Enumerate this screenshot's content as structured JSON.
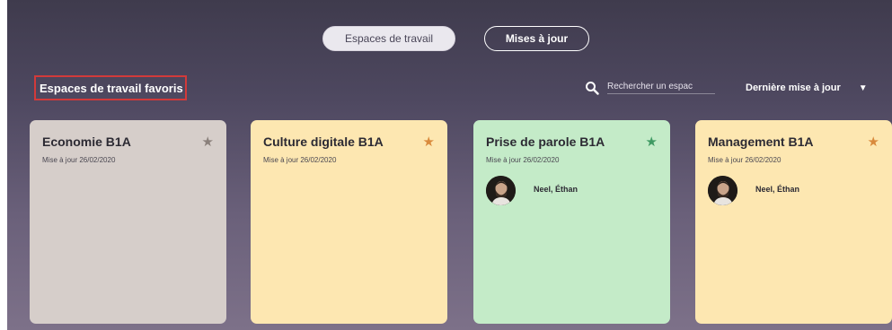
{
  "tabs": {
    "workspaces": "Espaces de travail",
    "updates": "Mises à jour"
  },
  "section": {
    "title": "Espaces de travail favoris"
  },
  "search": {
    "placeholder": "Rechercher un espac"
  },
  "sort": {
    "label": "Dernière mise à jour",
    "caret": "▼"
  },
  "colors": {
    "card_grey": "#d6ceca",
    "card_yellow": "#fde7b1",
    "card_green": "#c4ebc8",
    "star_grey": "#8a807b",
    "star_orange": "#d98a3c",
    "star_green": "#3f9a63"
  },
  "cards": [
    {
      "title": "Economie B1A",
      "date": "Mise à jour 26/02/2020",
      "star": "★"
    },
    {
      "title": "Culture digitale B1A",
      "date": "Mise à jour 26/02/2020",
      "star": "★"
    },
    {
      "title": "Prise de parole B1A",
      "date": "Mise à jour 26/02/2020",
      "star": "★",
      "member": "Neel, Éthan"
    },
    {
      "title": "Management B1A",
      "date": "Mise à jour 26/02/2020",
      "star": "★",
      "member": "Neel, Éthan"
    }
  ]
}
